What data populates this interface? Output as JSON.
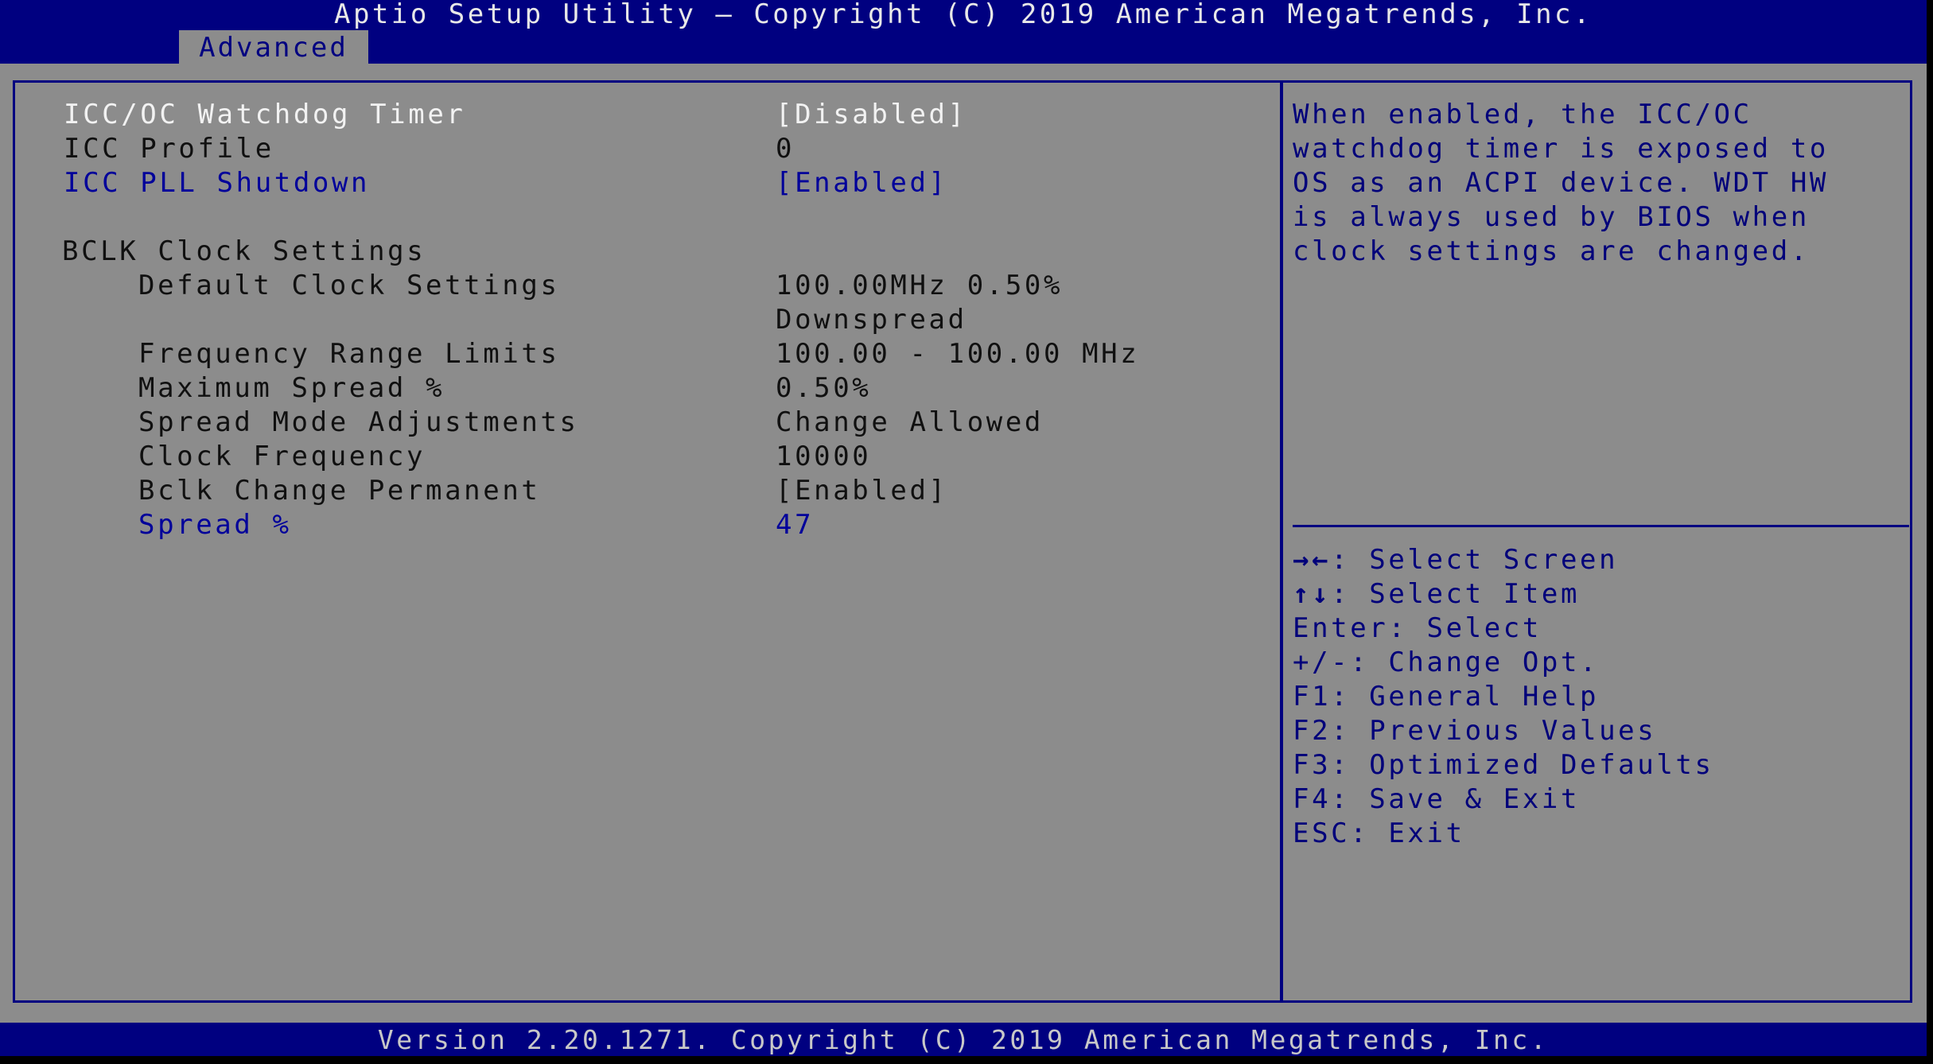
{
  "header": {
    "title": "Aptio Setup Utility – Copyright (C) 2019 American Megatrends, Inc.",
    "active_tab": "Advanced"
  },
  "settings": [
    {
      "label": "ICC/OC Watchdog Timer",
      "value": "[Disabled]",
      "state": "selected",
      "indent": false
    },
    {
      "label": "ICC Profile",
      "value": "0",
      "state": "readonly",
      "indent": false
    },
    {
      "label": "ICC PLL Shutdown",
      "value": "[Enabled]",
      "state": "editable",
      "indent": false
    },
    {
      "label": "BCLK Clock Settings",
      "value": "",
      "state": "heading",
      "indent": false
    },
    {
      "label": "Default Clock Settings",
      "value": "100.00MHz 0.50%",
      "value_line2": "Downspread",
      "state": "readonly",
      "indent": true
    },
    {
      "label": "Frequency Range Limits",
      "value": "100.00 - 100.00 MHz",
      "state": "readonly",
      "indent": true
    },
    {
      "label": "Maximum Spread %",
      "value": "0.50%",
      "state": "readonly",
      "indent": true
    },
    {
      "label": "Spread Mode Adjustments",
      "value": "Change Allowed",
      "state": "readonly",
      "indent": true
    },
    {
      "label": "Clock Frequency",
      "value": "10000",
      "state": "readonly",
      "indent": true
    },
    {
      "label": "Bclk Change Permanent",
      "value": "[Enabled]",
      "state": "readonly",
      "indent": true
    },
    {
      "label": "Spread %",
      "value": "47",
      "state": "editable",
      "indent": true
    }
  ],
  "help": {
    "description": [
      "When enabled, the ICC/OC",
      "watchdog timer is exposed to",
      "OS as an ACPI device. WDT HW",
      "is always used by BIOS when",
      "clock settings are changed."
    ],
    "keys": [
      {
        "key": "→←",
        "icon": "arrow-left-right-icon",
        "action": ": Select Screen"
      },
      {
        "key": "↑↓",
        "icon": "arrow-up-down-icon",
        "action": ": Select Item"
      },
      {
        "key": "Enter",
        "action": ": Select"
      },
      {
        "key": "+/-",
        "action": ": Change Opt."
      },
      {
        "key": "F1",
        "action": ": General Help"
      },
      {
        "key": "F2",
        "action": ": Previous Values"
      },
      {
        "key": "F3",
        "action": ": Optimized Defaults"
      },
      {
        "key": "F4",
        "action": ": Save & Exit"
      },
      {
        "key": "ESC",
        "action": ": Exit"
      }
    ]
  },
  "footer": {
    "text": "Version 2.20.1271. Copyright (C) 2019 American Megatrends, Inc."
  },
  "colors": {
    "header_bg": "#000080",
    "body_bg": "#8c8c8c",
    "selected_text": "#f2f2f2",
    "editable_text": "#00009a",
    "readonly_text": "#101010"
  }
}
